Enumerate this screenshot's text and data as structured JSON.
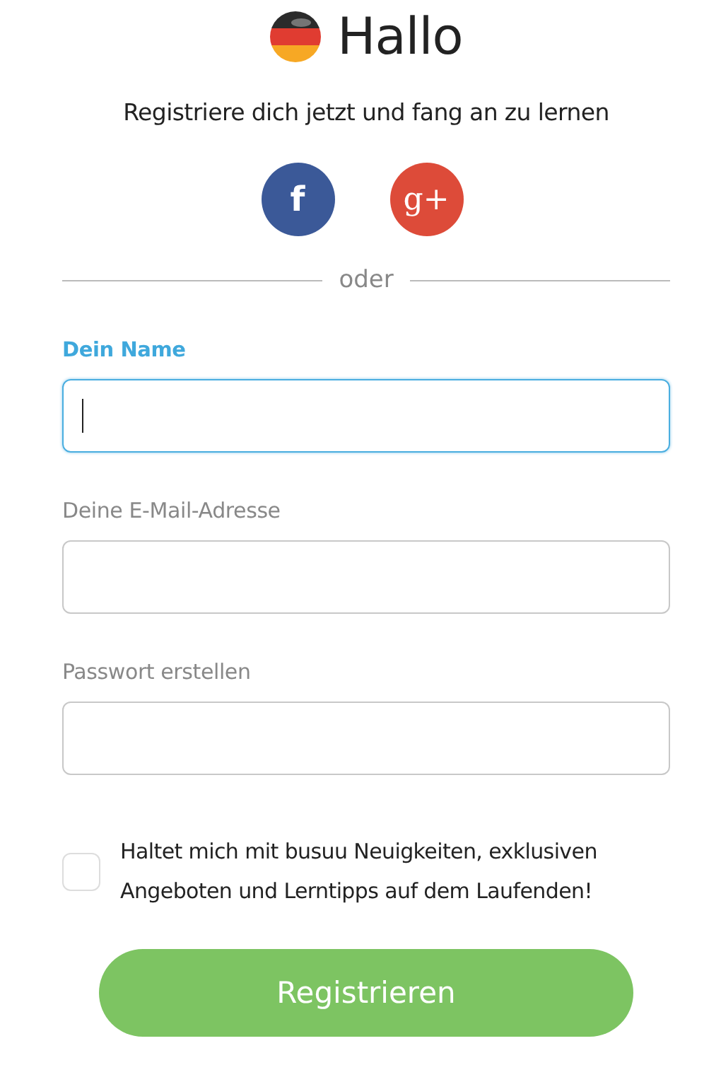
{
  "header": {
    "title": "Hallo",
    "subtitle": "Registriere dich jetzt und fang an zu lernen"
  },
  "social_buttons": [
    {
      "kind": "facebook",
      "label": "f"
    },
    {
      "kind": "google",
      "label": "g+"
    }
  ],
  "divider": {
    "label": "oder"
  },
  "fields": [
    {
      "label": "Dein Name",
      "focused": true
    },
    {
      "label": "Deine E-Mail-Adresse",
      "focused": false
    },
    {
      "label": "Passwort erstellen",
      "focused": false
    }
  ],
  "newsletter": {
    "label": "Haltet mich mit busuu Neuigkeiten, exklusiven Angeboten und Lerntipps auf dem Laufenden!",
    "checked": false
  },
  "submit_button": {
    "label": "Registrieren"
  }
}
